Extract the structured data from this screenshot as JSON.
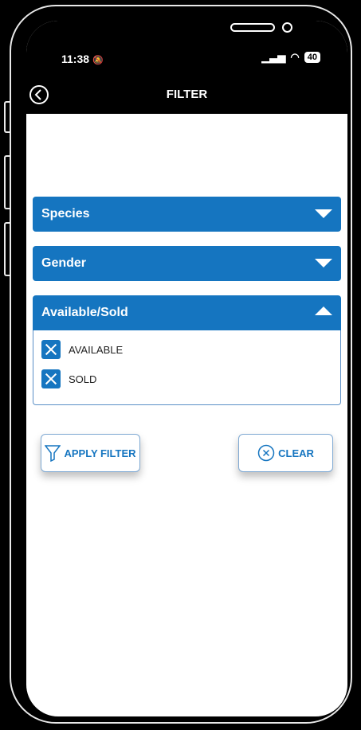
{
  "status": {
    "time": "11:38",
    "battery": "40"
  },
  "nav": {
    "title": "FILTER"
  },
  "filters": {
    "species_label": "Species",
    "gender_label": "Gender",
    "availability_label": "Available/Sold",
    "options": [
      {
        "label": "AVAILABLE",
        "checked": true
      },
      {
        "label": "SOLD",
        "checked": true
      }
    ]
  },
  "actions": {
    "apply_label": "APPLY FILTER",
    "clear_label": "CLEAR"
  },
  "colors": {
    "accent": "#1575c0",
    "background": "#000000"
  }
}
